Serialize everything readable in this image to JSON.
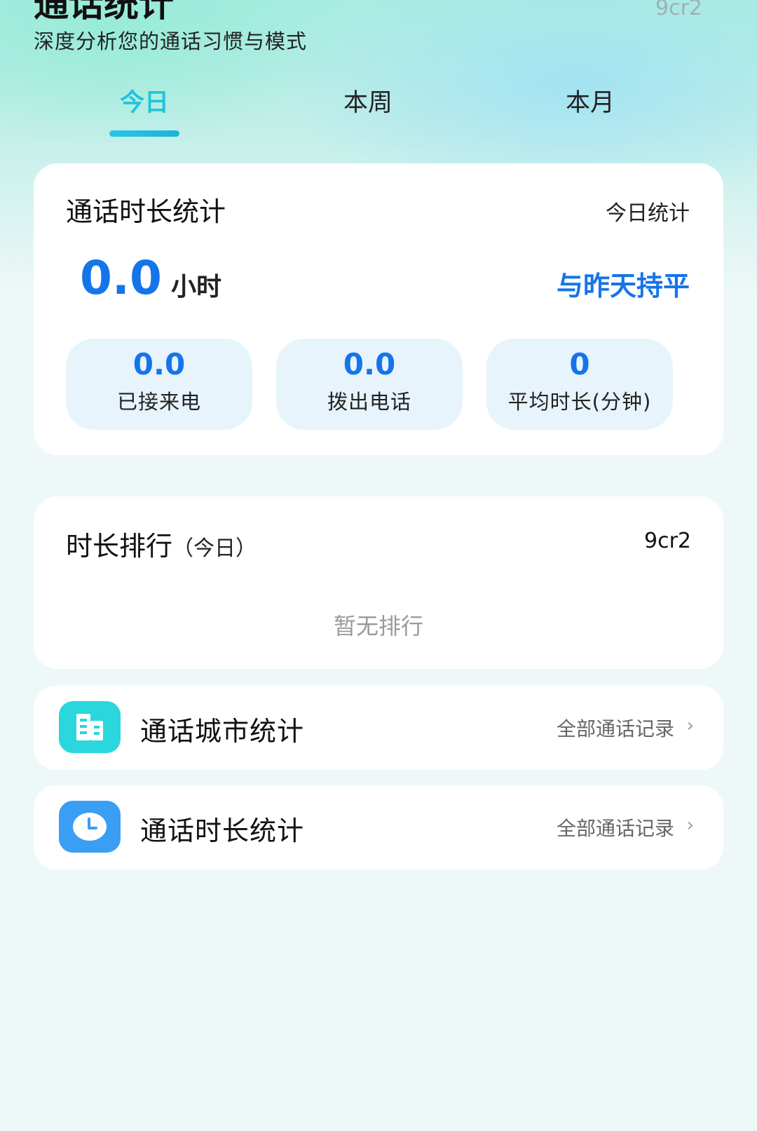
{
  "header": {
    "title": "通话统计",
    "version": "9cr2",
    "subtitle": "深度分析您的通话习惯与模式"
  },
  "tabs": [
    {
      "label": "今日",
      "active": true
    },
    {
      "label": "本周",
      "active": false
    },
    {
      "label": "本月",
      "active": false
    }
  ],
  "duration_card": {
    "title": "通话时长统计",
    "scope": "今日统计",
    "total_value": "0.0",
    "total_unit": "小时",
    "compare": "与昨天持平",
    "stats": [
      {
        "value": "0.0",
        "label": "已接来电"
      },
      {
        "value": "0.0",
        "label": "拨出电话"
      },
      {
        "value": "0",
        "label": "平均时长(分钟)"
      }
    ]
  },
  "ranking_card": {
    "title": "时长排行",
    "title_sub": "（今日）",
    "right_text": "9cr2",
    "empty_text": "暂无排行"
  },
  "rows": [
    {
      "icon": "building-icon",
      "title": "通话城市统计",
      "link": "全部通话记录",
      "chevron": "›"
    },
    {
      "icon": "clock-icon",
      "title": "通话时长统计",
      "link": "全部通话记录",
      "chevron": "›"
    }
  ],
  "colors": {
    "accent_blue": "#1674ea",
    "tab_active": "#22c3dc",
    "stat_bg": "#e7f4fc",
    "city_icon_bg": "#29d7dc",
    "clock_icon_bg": "#3a9ef4"
  }
}
